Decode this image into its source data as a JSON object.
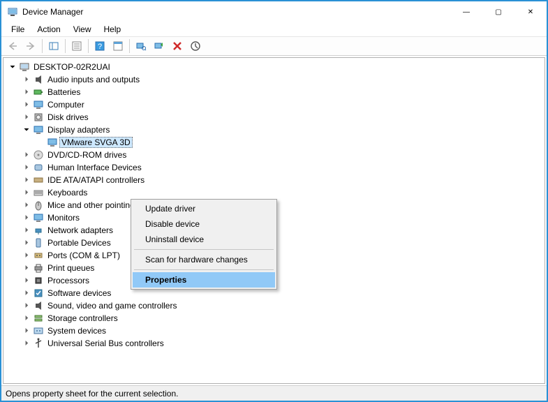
{
  "window": {
    "title": "Device Manager"
  },
  "window_controls": {
    "min": "—",
    "max": "▢",
    "close": "✕"
  },
  "menu": {
    "file": "File",
    "action": "Action",
    "view": "View",
    "help": "Help"
  },
  "tree": {
    "root": "DESKTOP-02R2UAI",
    "items": [
      {
        "label": "Audio inputs and outputs",
        "icon": "audio"
      },
      {
        "label": "Batteries",
        "icon": "battery"
      },
      {
        "label": "Computer",
        "icon": "monitor"
      },
      {
        "label": "Disk drives",
        "icon": "disk"
      },
      {
        "label": "Display adapters",
        "icon": "monitor",
        "expanded": true,
        "children": [
          {
            "label": "VMware SVGA 3D",
            "icon": "monitor",
            "selected": true
          }
        ]
      },
      {
        "label": "DVD/CD-ROM drives",
        "icon": "disc"
      },
      {
        "label": "Human Interface Devices",
        "icon": "hid"
      },
      {
        "label": "IDE ATA/ATAPI controllers",
        "icon": "ide"
      },
      {
        "label": "Keyboards",
        "icon": "keyboard"
      },
      {
        "label": "Mice and other pointing devices",
        "icon": "mouse"
      },
      {
        "label": "Monitors",
        "icon": "monitor"
      },
      {
        "label": "Network adapters",
        "icon": "network"
      },
      {
        "label": "Portable Devices",
        "icon": "portable"
      },
      {
        "label": "Ports (COM & LPT)",
        "icon": "port"
      },
      {
        "label": "Print queues",
        "icon": "printer"
      },
      {
        "label": "Processors",
        "icon": "cpu"
      },
      {
        "label": "Software devices",
        "icon": "software"
      },
      {
        "label": "Sound, video and game controllers",
        "icon": "audio"
      },
      {
        "label": "Storage controllers",
        "icon": "storage"
      },
      {
        "label": "System devices",
        "icon": "system"
      },
      {
        "label": "Universal Serial Bus controllers",
        "icon": "usb"
      }
    ]
  },
  "context_menu": {
    "update_driver": "Update driver",
    "disable_device": "Disable device",
    "uninstall_device": "Uninstall device",
    "scan_hardware": "Scan for hardware changes",
    "properties": "Properties"
  },
  "statusbar": {
    "text": "Opens property sheet for the current selection."
  }
}
